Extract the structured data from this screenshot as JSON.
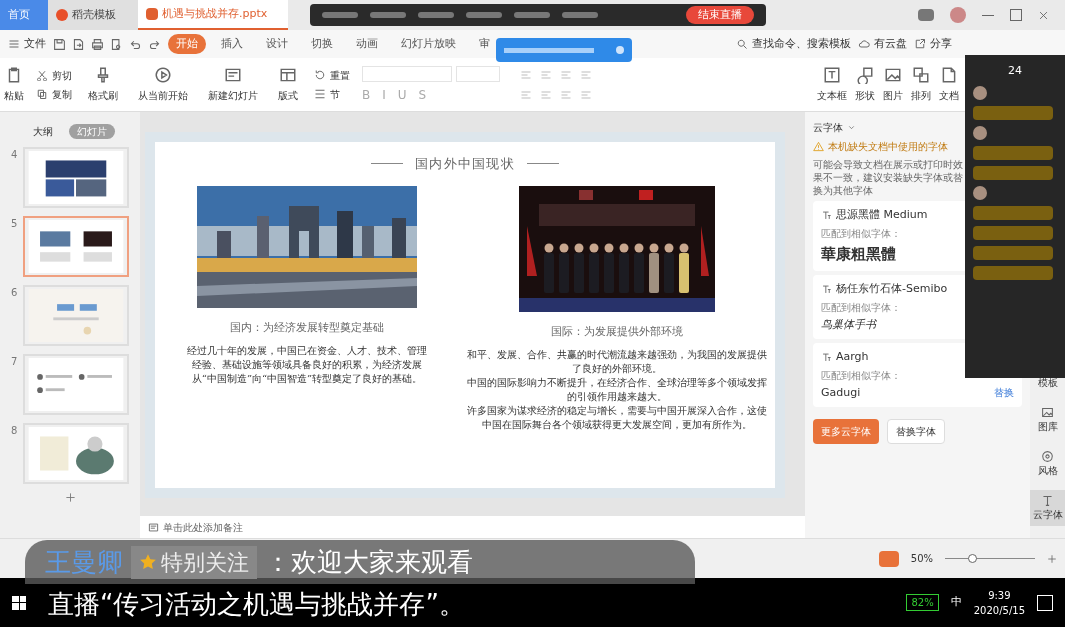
{
  "tabs": [
    {
      "label": "首页",
      "selected": false,
      "kind": "home"
    },
    {
      "label": "稻壳模板",
      "selected": false,
      "kind": "docer"
    },
    {
      "label": "机遇与挑战并存.pptx",
      "selected": true,
      "kind": "file"
    }
  ],
  "live_bar": {
    "end_button": "结束直播"
  },
  "menu": {
    "file": "文件",
    "items": [
      {
        "label": "开始",
        "selected": true
      },
      {
        "label": "插入",
        "selected": false
      },
      {
        "label": "设计",
        "selected": false
      },
      {
        "label": "切换",
        "selected": false
      },
      {
        "label": "动画",
        "selected": false
      },
      {
        "label": "幻灯片放映",
        "selected": false
      },
      {
        "label": "审",
        "selected": false
      }
    ],
    "search": "查找命令、搜索模板",
    "cloud": "有云盘",
    "share": "分享"
  },
  "ribbon": {
    "big": [
      {
        "label": "粘贴",
        "kind": "paste"
      },
      {
        "label": "格式刷",
        "kind": "brush"
      },
      {
        "label": "从当前开始",
        "kind": "play"
      },
      {
        "label": "新建幻灯片",
        "kind": "slide"
      },
      {
        "label": "版式",
        "kind": "layout"
      }
    ],
    "small": [
      {
        "label": "剪切",
        "kind": "cut"
      },
      {
        "label": "复制",
        "kind": "copy"
      }
    ],
    "small2": [
      {
        "label": "重置",
        "kind": "reset"
      },
      {
        "label": "节",
        "kind": "section"
      }
    ],
    "format": [
      "B",
      "I",
      "U",
      "S"
    ],
    "right": [
      {
        "label": "文本框",
        "kind": "textbox"
      },
      {
        "label": "形状",
        "kind": "shape"
      },
      {
        "label": "图片",
        "kind": "picture"
      },
      {
        "label": "排列",
        "kind": "arrange"
      },
      {
        "label": "文档",
        "kind": "doc"
      }
    ]
  },
  "outline": {
    "tabs": [
      {
        "label": "大纲",
        "selected": false
      },
      {
        "label": "幻灯片",
        "selected": true
      }
    ],
    "slides": [
      {
        "number": "4",
        "selected": false,
        "kind": "photos"
      },
      {
        "number": "5",
        "selected": true,
        "kind": "two"
      },
      {
        "number": "6",
        "selected": false,
        "kind": "title"
      },
      {
        "number": "7",
        "selected": false,
        "kind": "list"
      },
      {
        "number": "8",
        "selected": false,
        "kind": "figure"
      }
    ]
  },
  "slide": {
    "title": "国内外中国现状",
    "columns": [
      {
        "caption": "国内：为经济发展转型奠定基础",
        "kind": "city",
        "paragraphs": [
          "经过几十年的发展，中国已在资金、人才、技术、管理经验、基础设施等领域具备良好的积累，为经济发展从“中国制造”向“中国智造”转型奠定了良好的基础。"
        ]
      },
      {
        "caption": "国际：为发展提供外部环境",
        "kind": "people",
        "paragraphs": [
          "和平、发展、合作、共赢的时代潮流越来越强劲，为我国的发展提供了良好的外部环境。",
          "中国的国际影响力不断提升，在经济合作、全球治理等多个领域发挥的引领作用越来越大。",
          "许多国家为谋求经济的稳定与增长，需要与中国开展深入合作，这使中国在国际舞台各个领域获得更大发展空间，更加有所作为。"
        ]
      }
    ]
  },
  "notes": "单击此处添加备注",
  "font_panel": {
    "title": "云字体",
    "warning": "本机缺失文档中使用的字体",
    "description": "可能会导致文档在展示或打印时效果不一致，建议安装缺失字体或替换为其他字体",
    "fonts": [
      {
        "name": "思源黑體 Medium",
        "match_label": "匹配到相似字体：",
        "match": "華康粗黑體",
        "kind": "bold"
      },
      {
        "name": "杨任东竹石体-Semibo",
        "match_label": "匹配到相似字体：",
        "match": "鸟巢体手书",
        "kind": "script"
      },
      {
        "name": "Aargh",
        "match_label": "匹配到相似字体：",
        "match": "Gadugi",
        "kind": "plain",
        "action": "替换"
      }
    ],
    "buttons": [
      {
        "label": "更多云字体",
        "kind": "primary"
      },
      {
        "label": "替换字体",
        "kind": "secondary"
      }
    ]
  },
  "side_tools": [
    {
      "label": "模板",
      "kind": "template",
      "selected": false
    },
    {
      "label": "图库",
      "kind": "gallery",
      "selected": false
    },
    {
      "label": "风格",
      "kind": "style",
      "selected": false
    },
    {
      "label": "云字体",
      "kind": "font",
      "selected": true
    }
  ],
  "chat": {
    "count": "24",
    "messages": [
      {
        "kind": "avatar"
      },
      {
        "kind": "text"
      },
      {
        "kind": "avatar"
      },
      {
        "kind": "text"
      },
      {
        "kind": "text"
      },
      {
        "kind": "avatar"
      },
      {
        "kind": "text"
      },
      {
        "kind": "text"
      },
      {
        "kind": "text"
      },
      {
        "kind": "text"
      }
    ]
  },
  "status": {
    "zoom": "50%",
    "level": 0.3
  },
  "subtitle": {
    "name": "王曼卿",
    "badge": "特别关注",
    "line1": "：欢迎大家来观看",
    "line2": "直播“传习活动之机遇与挑战并存”。"
  },
  "taskbar": {
    "battery": "82%",
    "ime": "中",
    "time": "9:39",
    "date": "2020/5/15"
  }
}
